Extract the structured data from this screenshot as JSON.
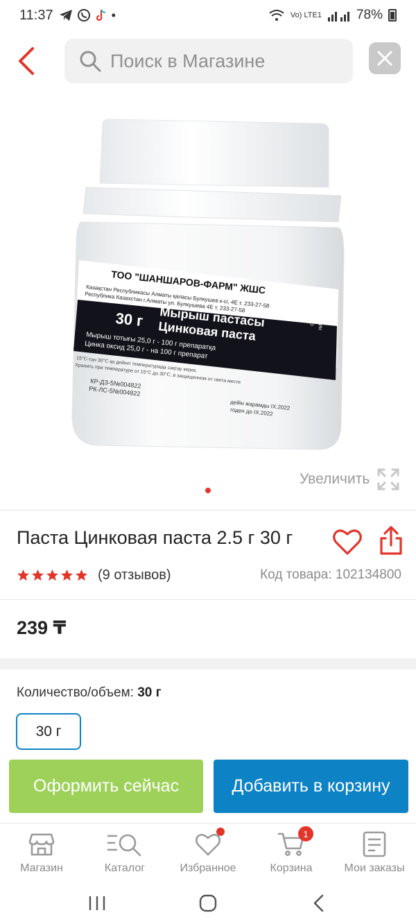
{
  "status_bar": {
    "time": "11:37",
    "network": "Vo) LTE1",
    "battery": "78%"
  },
  "search": {
    "placeholder": "Поиск в Магазине"
  },
  "gallery": {
    "zoom_label": "Увеличить",
    "image": {
      "brand": "ТОО \"ШАНШАРОВ-ФАРМ\" ЖШС",
      "addr1": "Казақстан Республикасы Алматы қаласы Булкушев к-сі, 4Е т. 233-27-58",
      "addr2": "Республика Казахстан г.Алматы ул. Булкушева 4Е т. 233-27-58",
      "weight": "30 г",
      "name_kz": "Мырыш пастасы",
      "name_ru": "Цинковая паста",
      "composition_kz": "Мырыш тотығы 25,0 г - 100 г препаратқа",
      "composition_ru": "Цинка оксид 25,0 г - на 100 г препарат",
      "side_text_1": "СЫРТҚА",
      "side_text_2": "НАРУЖНОЕ",
      "storage_kz": "15°С-тан 30°С қа дейінгі температурада сақтау керек.",
      "storage_ru": "Хранить при температуре от 15°С до 30°С, в защищенном от света месте",
      "reg1": "КР-ДЗ-5№004822",
      "reg2": "РК-ЛС-5№004822",
      "exp_kz": "дейін жарамды IX.2022",
      "exp_ru": "годен до IX.2022"
    }
  },
  "product": {
    "title": "Паста Цинковая паста 2.5 г 30 г",
    "reviews": "(9 отзывов)",
    "rating": 5,
    "sku_label": "Код товара:",
    "sku_value": "102134800",
    "price": "239 ₸"
  },
  "options": {
    "label": "Количество/объем:",
    "selected": "30 г",
    "chips": [
      "30 г"
    ]
  },
  "actions": {
    "checkout": "Оформить сейчас",
    "add_to_cart": "Добавить в корзину"
  },
  "bottom_nav": {
    "items": [
      {
        "label": "Магазин",
        "icon": "store-icon"
      },
      {
        "label": "Каталог",
        "icon": "catalog-search-icon"
      },
      {
        "label": "Избранное",
        "icon": "heart-icon"
      },
      {
        "label": "Корзина",
        "icon": "cart-icon"
      },
      {
        "label": "Мои заказы",
        "icon": "orders-icon"
      }
    ],
    "cart_count": "1"
  },
  "colors": {
    "accent_red": "#e2352a",
    "primary_blue": "#0d83c5",
    "checkout_green": "#9dd15a"
  }
}
